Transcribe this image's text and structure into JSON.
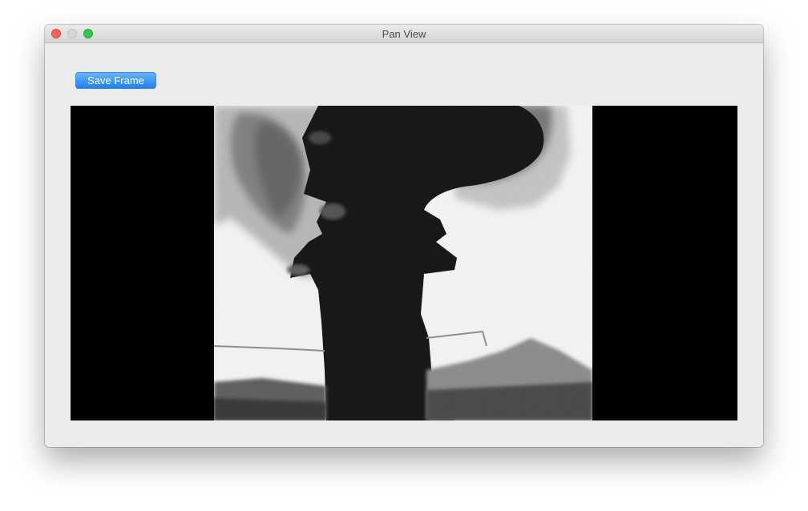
{
  "window": {
    "title": "Pan View"
  },
  "toolbar": {
    "save_frame_label": "Save Frame"
  },
  "colors": {
    "accent": "#1a82fb",
    "close": "#fc605c",
    "zoom": "#34c84a"
  }
}
